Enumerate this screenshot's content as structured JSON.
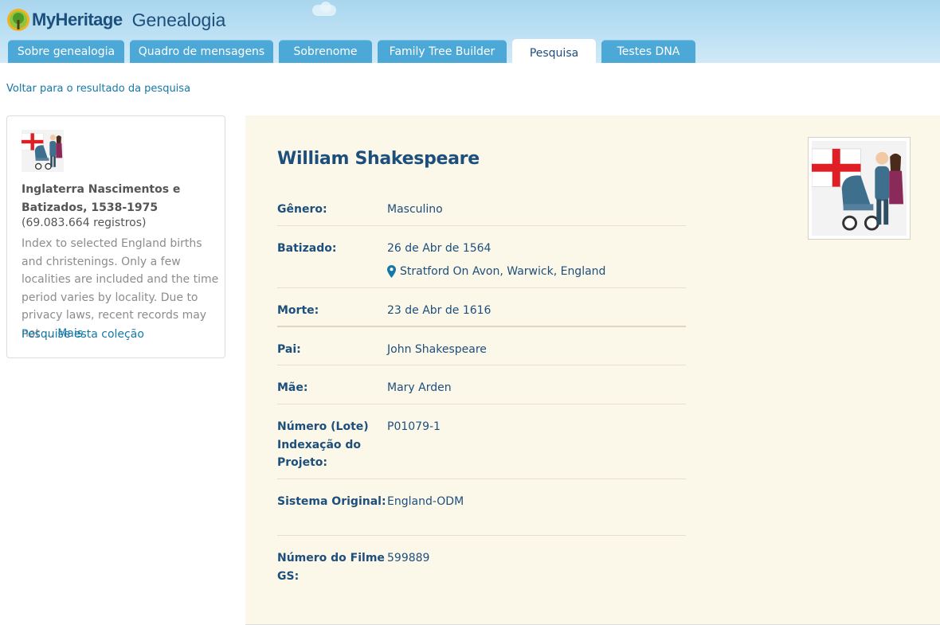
{
  "header": {
    "brand": "MyHeritage",
    "section_title": "Genealogia",
    "tabs": [
      {
        "label": "Sobre genealogia",
        "active": false
      },
      {
        "label": "Quadro de mensagens",
        "active": false
      },
      {
        "label": "Sobrenome",
        "active": false
      },
      {
        "label": "Family Tree Builder",
        "active": false
      },
      {
        "label": "Pesquisa",
        "active": true
      },
      {
        "label": "Testes DNA",
        "active": false
      }
    ]
  },
  "back_link": "Voltar para o resultado da pesquisa",
  "collection": {
    "title": "Inglaterra Nascimentos e Batizados, 1538-1975",
    "count": "(69.083.664 registros)",
    "description": "Index to selected England births and christenings. Only a few localities are included and the time period varies by locality. Due to privacy laws, recent records may not ...",
    "more_label": "Mais",
    "search_link": "Pesquise esta coleção"
  },
  "record": {
    "name": "William Shakespeare",
    "fields": [
      {
        "label": "Gênero:",
        "value": "Masculino"
      },
      {
        "label": "Batizado:",
        "value": "26 de Abr de 1564",
        "location": "Stratford On Avon, Warwick, England"
      },
      {
        "label": "Morte:",
        "value": "23 de Abr de 1616"
      },
      {
        "label": "Pai:",
        "value": "John Shakespeare"
      },
      {
        "label": "Mãe:",
        "value": "Mary Arden"
      },
      {
        "label": "Número (Lote) Indexação do Projeto:",
        "value": "P01079-1"
      },
      {
        "label": "Sistema Original:",
        "value": "England-ODM"
      },
      {
        "label": "Número do Filme GS:",
        "value": "599889"
      }
    ]
  },
  "colors": {
    "brand_blue": "#1d4f7d",
    "link_blue": "#1578a8",
    "tab_blue": "#4ca8d6",
    "record_bg": "#fbf7e9",
    "flag_red": "#e01e26"
  },
  "icons": {
    "logo": "tree-logo-icon",
    "location": "map-pin-icon",
    "collection_image": "england-flag-family-stroller-icon"
  }
}
